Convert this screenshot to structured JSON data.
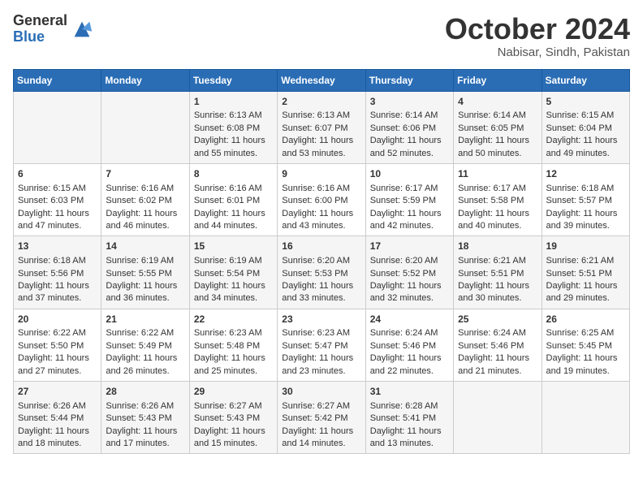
{
  "header": {
    "logo_general": "General",
    "logo_blue": "Blue",
    "month_title": "October 2024",
    "location": "Nabisar, Sindh, Pakistan"
  },
  "weekdays": [
    "Sunday",
    "Monday",
    "Tuesday",
    "Wednesday",
    "Thursday",
    "Friday",
    "Saturday"
  ],
  "weeks": [
    [
      {
        "day": "",
        "sunrise": "",
        "sunset": "",
        "daylight": ""
      },
      {
        "day": "",
        "sunrise": "",
        "sunset": "",
        "daylight": ""
      },
      {
        "day": "1",
        "sunrise": "Sunrise: 6:13 AM",
        "sunset": "Sunset: 6:08 PM",
        "daylight": "Daylight: 11 hours and 55 minutes."
      },
      {
        "day": "2",
        "sunrise": "Sunrise: 6:13 AM",
        "sunset": "Sunset: 6:07 PM",
        "daylight": "Daylight: 11 hours and 53 minutes."
      },
      {
        "day": "3",
        "sunrise": "Sunrise: 6:14 AM",
        "sunset": "Sunset: 6:06 PM",
        "daylight": "Daylight: 11 hours and 52 minutes."
      },
      {
        "day": "4",
        "sunrise": "Sunrise: 6:14 AM",
        "sunset": "Sunset: 6:05 PM",
        "daylight": "Daylight: 11 hours and 50 minutes."
      },
      {
        "day": "5",
        "sunrise": "Sunrise: 6:15 AM",
        "sunset": "Sunset: 6:04 PM",
        "daylight": "Daylight: 11 hours and 49 minutes."
      }
    ],
    [
      {
        "day": "6",
        "sunrise": "Sunrise: 6:15 AM",
        "sunset": "Sunset: 6:03 PM",
        "daylight": "Daylight: 11 hours and 47 minutes."
      },
      {
        "day": "7",
        "sunrise": "Sunrise: 6:16 AM",
        "sunset": "Sunset: 6:02 PM",
        "daylight": "Daylight: 11 hours and 46 minutes."
      },
      {
        "day": "8",
        "sunrise": "Sunrise: 6:16 AM",
        "sunset": "Sunset: 6:01 PM",
        "daylight": "Daylight: 11 hours and 44 minutes."
      },
      {
        "day": "9",
        "sunrise": "Sunrise: 6:16 AM",
        "sunset": "Sunset: 6:00 PM",
        "daylight": "Daylight: 11 hours and 43 minutes."
      },
      {
        "day": "10",
        "sunrise": "Sunrise: 6:17 AM",
        "sunset": "Sunset: 5:59 PM",
        "daylight": "Daylight: 11 hours and 42 minutes."
      },
      {
        "day": "11",
        "sunrise": "Sunrise: 6:17 AM",
        "sunset": "Sunset: 5:58 PM",
        "daylight": "Daylight: 11 hours and 40 minutes."
      },
      {
        "day": "12",
        "sunrise": "Sunrise: 6:18 AM",
        "sunset": "Sunset: 5:57 PM",
        "daylight": "Daylight: 11 hours and 39 minutes."
      }
    ],
    [
      {
        "day": "13",
        "sunrise": "Sunrise: 6:18 AM",
        "sunset": "Sunset: 5:56 PM",
        "daylight": "Daylight: 11 hours and 37 minutes."
      },
      {
        "day": "14",
        "sunrise": "Sunrise: 6:19 AM",
        "sunset": "Sunset: 5:55 PM",
        "daylight": "Daylight: 11 hours and 36 minutes."
      },
      {
        "day": "15",
        "sunrise": "Sunrise: 6:19 AM",
        "sunset": "Sunset: 5:54 PM",
        "daylight": "Daylight: 11 hours and 34 minutes."
      },
      {
        "day": "16",
        "sunrise": "Sunrise: 6:20 AM",
        "sunset": "Sunset: 5:53 PM",
        "daylight": "Daylight: 11 hours and 33 minutes."
      },
      {
        "day": "17",
        "sunrise": "Sunrise: 6:20 AM",
        "sunset": "Sunset: 5:52 PM",
        "daylight": "Daylight: 11 hours and 32 minutes."
      },
      {
        "day": "18",
        "sunrise": "Sunrise: 6:21 AM",
        "sunset": "Sunset: 5:51 PM",
        "daylight": "Daylight: 11 hours and 30 minutes."
      },
      {
        "day": "19",
        "sunrise": "Sunrise: 6:21 AM",
        "sunset": "Sunset: 5:51 PM",
        "daylight": "Daylight: 11 hours and 29 minutes."
      }
    ],
    [
      {
        "day": "20",
        "sunrise": "Sunrise: 6:22 AM",
        "sunset": "Sunset: 5:50 PM",
        "daylight": "Daylight: 11 hours and 27 minutes."
      },
      {
        "day": "21",
        "sunrise": "Sunrise: 6:22 AM",
        "sunset": "Sunset: 5:49 PM",
        "daylight": "Daylight: 11 hours and 26 minutes."
      },
      {
        "day": "22",
        "sunrise": "Sunrise: 6:23 AM",
        "sunset": "Sunset: 5:48 PM",
        "daylight": "Daylight: 11 hours and 25 minutes."
      },
      {
        "day": "23",
        "sunrise": "Sunrise: 6:23 AM",
        "sunset": "Sunset: 5:47 PM",
        "daylight": "Daylight: 11 hours and 23 minutes."
      },
      {
        "day": "24",
        "sunrise": "Sunrise: 6:24 AM",
        "sunset": "Sunset: 5:46 PM",
        "daylight": "Daylight: 11 hours and 22 minutes."
      },
      {
        "day": "25",
        "sunrise": "Sunrise: 6:24 AM",
        "sunset": "Sunset: 5:46 PM",
        "daylight": "Daylight: 11 hours and 21 minutes."
      },
      {
        "day": "26",
        "sunrise": "Sunrise: 6:25 AM",
        "sunset": "Sunset: 5:45 PM",
        "daylight": "Daylight: 11 hours and 19 minutes."
      }
    ],
    [
      {
        "day": "27",
        "sunrise": "Sunrise: 6:26 AM",
        "sunset": "Sunset: 5:44 PM",
        "daylight": "Daylight: 11 hours and 18 minutes."
      },
      {
        "day": "28",
        "sunrise": "Sunrise: 6:26 AM",
        "sunset": "Sunset: 5:43 PM",
        "daylight": "Daylight: 11 hours and 17 minutes."
      },
      {
        "day": "29",
        "sunrise": "Sunrise: 6:27 AM",
        "sunset": "Sunset: 5:43 PM",
        "daylight": "Daylight: 11 hours and 15 minutes."
      },
      {
        "day": "30",
        "sunrise": "Sunrise: 6:27 AM",
        "sunset": "Sunset: 5:42 PM",
        "daylight": "Daylight: 11 hours and 14 minutes."
      },
      {
        "day": "31",
        "sunrise": "Sunrise: 6:28 AM",
        "sunset": "Sunset: 5:41 PM",
        "daylight": "Daylight: 11 hours and 13 minutes."
      },
      {
        "day": "",
        "sunrise": "",
        "sunset": "",
        "daylight": ""
      },
      {
        "day": "",
        "sunrise": "",
        "sunset": "",
        "daylight": ""
      }
    ]
  ]
}
